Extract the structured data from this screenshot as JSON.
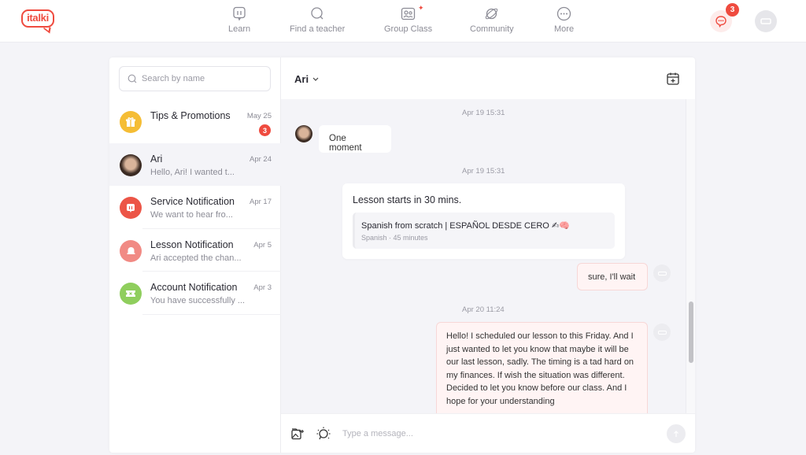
{
  "brand": {
    "logo_text": "italki",
    "accent": "#ef4b3f"
  },
  "nav": {
    "items": [
      {
        "label": "Learn",
        "icon": "learn-icon"
      },
      {
        "label": "Find a teacher",
        "icon": "search-icon"
      },
      {
        "label": "Group Class",
        "icon": "group-class-icon",
        "sparkle": "✦"
      },
      {
        "label": "Community",
        "icon": "planet-icon"
      },
      {
        "label": "More",
        "icon": "more-icon"
      }
    ],
    "messages_badge": "3"
  },
  "sidebar": {
    "search_placeholder": "Search by name",
    "conversations": [
      {
        "name": "Tips & Promotions",
        "date": "May 25",
        "preview": "",
        "badge": "3",
        "icon": "gift-icon",
        "color": "#f5bd35"
      },
      {
        "name": "Ari",
        "date": "Apr 24",
        "preview": "Hello, Ari! I wanted t...",
        "icon": "avatar"
      },
      {
        "name": "Service Notification",
        "date": "Apr 17",
        "preview": "We want to hear fro...",
        "icon": "italki-icon",
        "color": "#ec5547"
      },
      {
        "name": "Lesson Notification",
        "date": "Apr 5",
        "preview": "Ari accepted the chan...",
        "icon": "bell-icon",
        "color": "#f18a84"
      },
      {
        "name": "Account Notification",
        "date": "Apr 3",
        "preview": "You have successfully ...",
        "icon": "ticket-icon",
        "color": "#8fce5d"
      }
    ]
  },
  "chat": {
    "title": "Ari",
    "messages": [
      {
        "timestamp": "Apr 19 15:31",
        "text": "One moment"
      },
      {
        "timestamp": "Apr 19 15:31",
        "card_title": "Lesson starts in 30 mins.",
        "lesson_name": "Spanish from scratch | ESPAÑOL DESDE CERO ✍🧠",
        "lesson_meta": "Spanish · 45 minutes"
      },
      {
        "text": "sure, I'll wait"
      },
      {
        "timestamp": "Apr 20 11:24",
        "text": "Hello! I scheduled our lesson to this Friday. And I just wanted to let you know that maybe it will be our last lesson, sadly. The timing is a tad hard on my finances. If wish the situation was different. Decided to let you know before our class. And I hope for your understanding"
      }
    ],
    "composer_placeholder": "Type a message..."
  }
}
